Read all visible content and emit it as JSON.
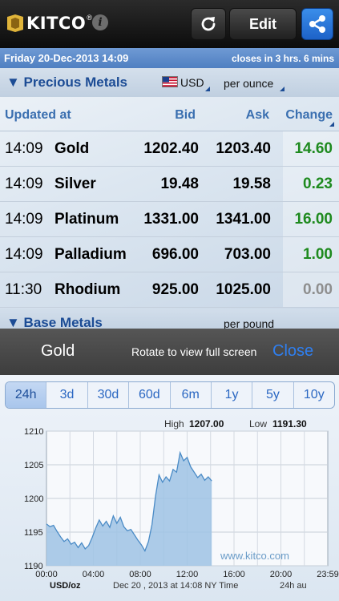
{
  "navbar": {
    "logo_text": "KITCO",
    "logo_reg": "®",
    "info_label": "i",
    "edit_label": "Edit"
  },
  "datebar": {
    "date": "Friday 20-Dec-2013 14:09",
    "closes": "closes in 3 hrs. 6 mins"
  },
  "precious": {
    "title": "▼ Precious Metals",
    "currency": "USD",
    "unit": "per ounce",
    "headers": {
      "updated": "Updated at",
      "bid": "Bid",
      "ask": "Ask",
      "change": "Change"
    },
    "rows": [
      {
        "time": "14:09",
        "name": "Gold",
        "bid": "1202.40",
        "ask": "1203.40",
        "change": "14.60",
        "color": "#1e8a1e"
      },
      {
        "time": "14:09",
        "name": "Silver",
        "bid": "19.48",
        "ask": "19.58",
        "change": "0.23",
        "color": "#1e8a1e"
      },
      {
        "time": "14:09",
        "name": "Platinum",
        "bid": "1331.00",
        "ask": "1341.00",
        "change": "16.00",
        "color": "#1e8a1e"
      },
      {
        "time": "14:09",
        "name": "Palladium",
        "bid": "696.00",
        "ask": "703.00",
        "change": "1.00",
        "color": "#1e8a1e"
      },
      {
        "time": "11:30",
        "name": "Rhodium",
        "bid": "925.00",
        "ask": "1025.00",
        "change": "0.00",
        "color": "#8e8e8e"
      }
    ]
  },
  "base": {
    "title": "▼ Base Metals",
    "unit": "per pound"
  },
  "overlay": {
    "title": "Gold",
    "hint": "Rotate to view full screen",
    "close": "Close"
  },
  "tabs": [
    "24h",
    "3d",
    "30d",
    "60d",
    "6m",
    "1y",
    "5y",
    "10y"
  ],
  "active_tab": "24h",
  "chart_data": {
    "type": "area",
    "high_label": "High",
    "high": "1207.00",
    "low_label": "Low",
    "low": "1191.30",
    "ylim": [
      1190,
      1210
    ],
    "yticks": [
      "1210",
      "1205",
      "1200",
      "1195",
      "1190"
    ],
    "xticks": [
      "00:00",
      "04:00",
      "08:00",
      "12:00",
      "16:00",
      "20:00",
      "23:59"
    ],
    "xlim": [
      0,
      24
    ],
    "unit_label": "USD/oz",
    "footer": "Dec 20 , 2013 at 14:08 NY Time",
    "watermark": "www.kitco.com",
    "corner_label": "24h au",
    "x": [
      0,
      0.3,
      0.6,
      0.9,
      1.2,
      1.5,
      1.8,
      2.1,
      2.4,
      2.7,
      3.0,
      3.3,
      3.6,
      3.9,
      4.2,
      4.5,
      4.8,
      5.1,
      5.4,
      5.7,
      6.0,
      6.3,
      6.6,
      6.9,
      7.2,
      7.5,
      7.8,
      8.1,
      8.4,
      8.7,
      9.0,
      9.3,
      9.6,
      9.9,
      10.2,
      10.5,
      10.8,
      11.1,
      11.4,
      11.7,
      12.0,
      12.3,
      12.6,
      12.9,
      13.2,
      13.5,
      13.8,
      14.1
    ],
    "values": [
      1196.2,
      1195.8,
      1196.0,
      1195.1,
      1194.3,
      1193.6,
      1194.0,
      1193.2,
      1193.5,
      1192.7,
      1193.4,
      1192.5,
      1193.0,
      1194.2,
      1195.6,
      1196.8,
      1195.9,
      1196.6,
      1195.7,
      1197.4,
      1196.3,
      1197.2,
      1195.8,
      1195.2,
      1195.4,
      1194.6,
      1193.8,
      1193.1,
      1192.2,
      1193.6,
      1196.1,
      1200.3,
      1203.5,
      1202.4,
      1203.2,
      1202.6,
      1204.3,
      1203.9,
      1206.8,
      1205.6,
      1206.1,
      1204.7,
      1203.9,
      1203.1,
      1203.6,
      1202.7,
      1203.2,
      1202.6
    ]
  },
  "colors": {
    "positive": "#1e8a1e",
    "neutral": "#8e8e8e",
    "accent": "#1c4c95",
    "close": "#2f7ff0",
    "area_fill": "#9fc3e4",
    "area_line": "#4a8bc6"
  }
}
